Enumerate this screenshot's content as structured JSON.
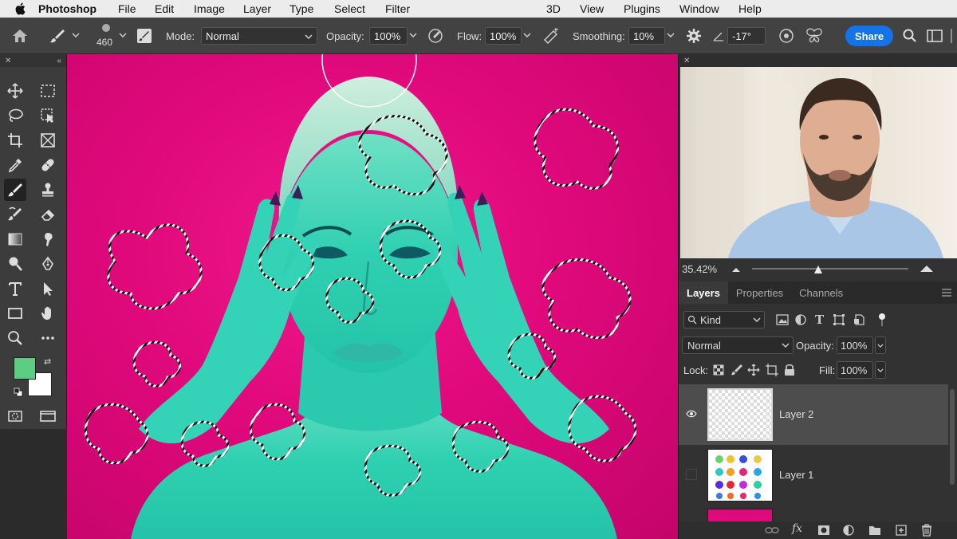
{
  "menubar": {
    "app": "Photoshop",
    "items": [
      "File",
      "Edit",
      "Image",
      "Layer",
      "Type",
      "Select",
      "Filter",
      "3D",
      "View",
      "Plugins",
      "Window",
      "Help"
    ]
  },
  "options": {
    "brush_size": "460",
    "mode_label": "Mode:",
    "mode_value": "Normal",
    "opacity_label": "Opacity:",
    "opacity_value": "100%",
    "flow_label": "Flow:",
    "flow_value": "100%",
    "smoothing_label": "Smoothing:",
    "smoothing_value": "10%",
    "angle_value": "-17°",
    "share_label": "Share"
  },
  "colors": {
    "foreground": "#5dcd83",
    "background": "#ffffff",
    "canvas_bg": "#e0097c",
    "accent": "#1473e6"
  },
  "navigator": {
    "zoom": "35.42%"
  },
  "layers_panel": {
    "tabs": [
      "Layers",
      "Properties",
      "Channels"
    ],
    "filter_label": "Kind",
    "blend_mode": "Normal",
    "opacity_label": "Opacity:",
    "opacity_value": "100%",
    "lock_label": "Lock:",
    "fill_label": "Fill:",
    "fill_value": "100%",
    "layers": [
      {
        "name": "Layer 2",
        "visible": true,
        "selected": true
      },
      {
        "name": "Layer 1",
        "visible": false,
        "selected": false
      }
    ]
  }
}
